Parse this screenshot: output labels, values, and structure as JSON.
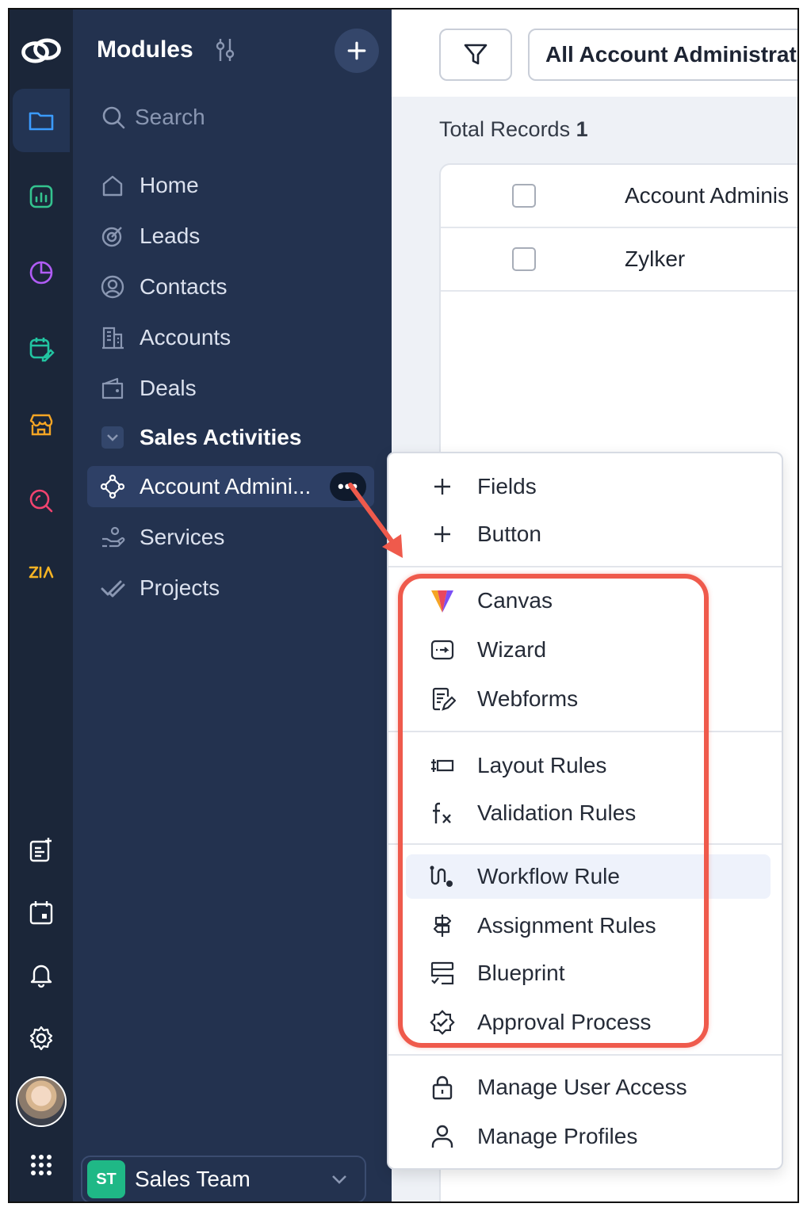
{
  "rail": {
    "icons": [
      "crm-logo-icon",
      "modules-folder-icon",
      "analytics-icon",
      "reports-pie-icon",
      "activities-calendar-icon",
      "marketplace-store-icon",
      "search-insights-icon",
      "zia-icon",
      "new-note-icon",
      "calendar-icon",
      "notification-bell-icon",
      "settings-gear-icon",
      "user-avatar",
      "apps-grid-icon"
    ]
  },
  "sidebar": {
    "title": "Modules",
    "search_placeholder": "Search",
    "items": [
      {
        "label": "Home"
      },
      {
        "label": "Leads"
      },
      {
        "label": "Contacts"
      },
      {
        "label": "Accounts"
      },
      {
        "label": "Deals"
      },
      {
        "label": "Sales Activities"
      },
      {
        "label": "Account Admini..."
      },
      {
        "label": "Services"
      },
      {
        "label": "Projects"
      }
    ],
    "more_label": "•••",
    "team": {
      "badge": "ST",
      "label": "Sales Team"
    }
  },
  "main": {
    "view_label": "All Account Administrat",
    "total_label": "Total Records",
    "total_value": "1",
    "table": {
      "header": "Account Adminis",
      "rows": [
        "Zylker"
      ]
    }
  },
  "menu": {
    "items": [
      {
        "label": "Fields"
      },
      {
        "label": "Button"
      },
      {
        "label": "Canvas"
      },
      {
        "label": "Wizard"
      },
      {
        "label": "Webforms"
      },
      {
        "label": "Layout Rules"
      },
      {
        "label": "Validation Rules"
      },
      {
        "label": "Workflow Rule"
      },
      {
        "label": "Assignment Rules"
      },
      {
        "label": "Blueprint"
      },
      {
        "label": "Approval Process"
      },
      {
        "label": "Manage User Access"
      },
      {
        "label": "Manage Profiles"
      }
    ]
  },
  "colors": {
    "rail_bg": "#1b2639",
    "sidebar_bg": "#23324f",
    "highlight": "#ef5a4c",
    "team_badge": "#1fb886"
  }
}
